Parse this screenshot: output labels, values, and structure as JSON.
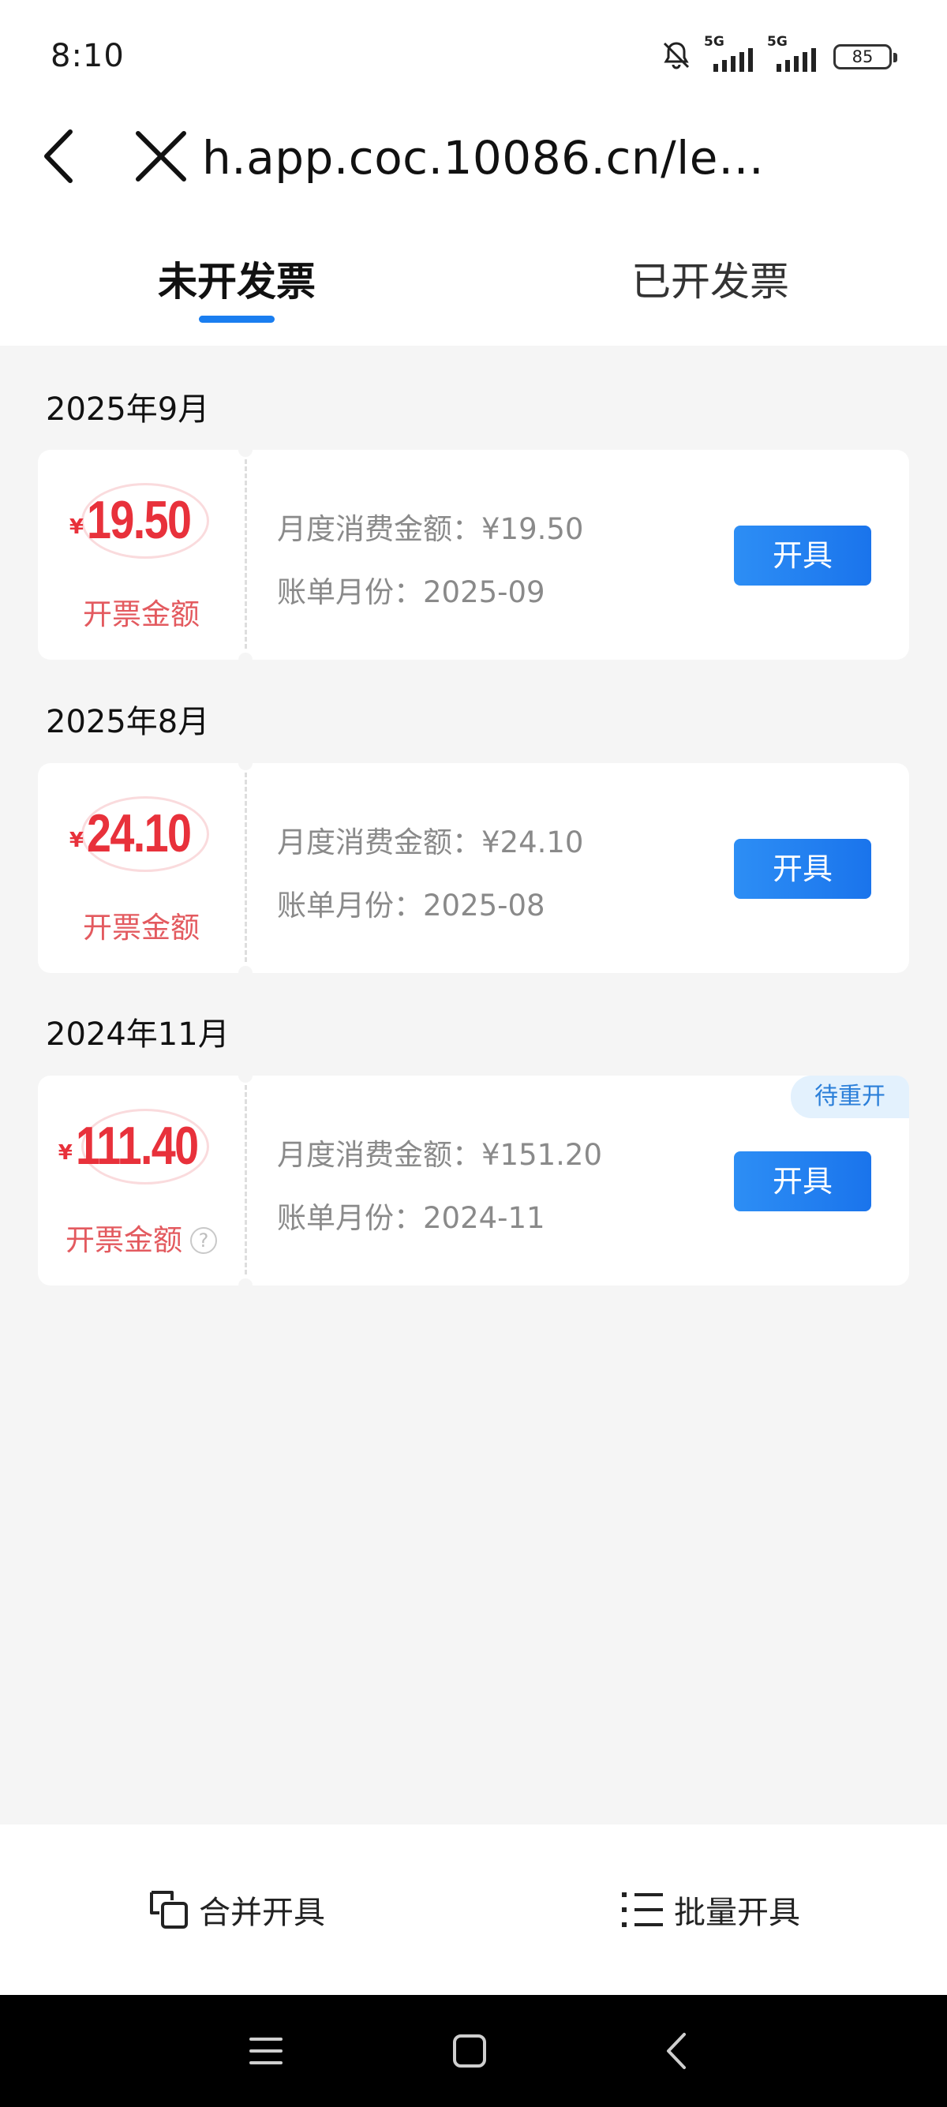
{
  "status_bar": {
    "time": "8:10",
    "network1": "5G",
    "network2": "5G",
    "battery": "85"
  },
  "nav": {
    "url": "h.app.coc.10086.cn/lea..."
  },
  "tabs": [
    {
      "label": "未开发票",
      "active": true
    },
    {
      "label": "已开发票",
      "active": false
    }
  ],
  "invoices": [
    {
      "month": "2025年9月",
      "currency": "¥",
      "amount": "19.50",
      "amount_label": "开票金额",
      "monthly_spend": "月度消费金额：¥19.50",
      "bill_month": "账单月份：2025-09",
      "action": "开具"
    },
    {
      "month": "2025年8月",
      "currency": "¥",
      "amount": "24.10",
      "amount_label": "开票金额",
      "monthly_spend": "月度消费金额：¥24.10",
      "bill_month": "账单月份：2025-08",
      "action": "开具"
    },
    {
      "month": "2024年11月",
      "currency": "¥",
      "amount": "111.40",
      "amount_label": "开票金额",
      "help": "?",
      "monthly_spend": "月度消费金额：¥151.20",
      "bill_month": "账单月份：2024-11",
      "action": "开具",
      "badge": "待重开"
    }
  ],
  "toolbar": {
    "merge_label": "合并开具",
    "batch_label": "批量开具"
  },
  "colors": {
    "accent": "#1a7ef0",
    "amount_red": "#e8313b",
    "background": "#f5f5f5"
  }
}
